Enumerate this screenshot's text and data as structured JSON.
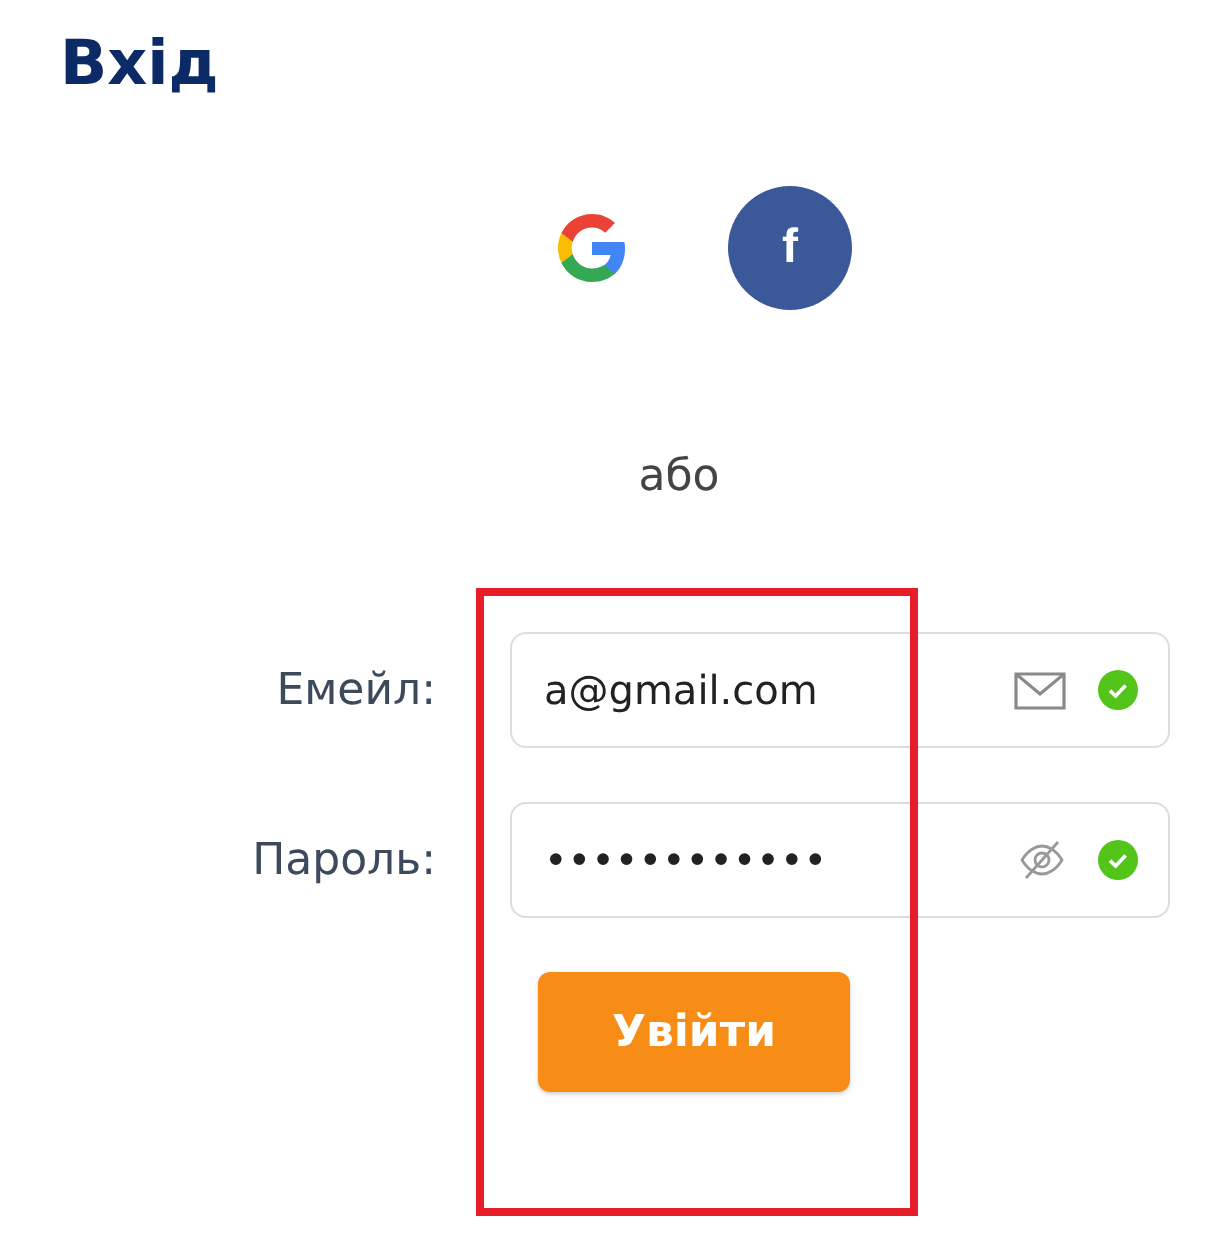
{
  "title": "Вхід",
  "social": [
    {
      "kind": "google"
    },
    {
      "kind": "facebook",
      "label": "f"
    }
  ],
  "divider_text": "або",
  "fields": [
    {
      "label": "Емейл:",
      "value": "a@gmail.com",
      "kind": "email",
      "valid": true
    },
    {
      "label": "Пароль:",
      "value": "••••••••••••",
      "kind": "password",
      "valid": true
    }
  ],
  "submit": "Увійти",
  "highlight": true
}
